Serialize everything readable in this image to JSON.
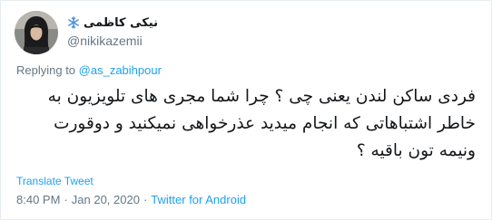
{
  "tweet": {
    "author": {
      "display_name": "نیکی کاظمی",
      "handle": "@nikikazemii",
      "name_emoji_icon": "snowflake-icon"
    },
    "replying_to": {
      "prefix": "Replying to",
      "mention": "@as_zabihpour"
    },
    "text": "فردی ساکن لندن یعنی چی ؟ چرا شما مجری های تلویزیون به خاطر اشتباهاتی که انجام میدید عذرخواهی نمیکنید و دوقورت ونیمه تون باقیه ؟",
    "translate_label": "Translate Tweet",
    "time": "8:40 PM",
    "date": "Jan 20, 2020",
    "separator": "·",
    "source": "Twitter for Android"
  },
  "colors": {
    "link": "#1da1f2",
    "muted": "#657786",
    "text": "#14171a",
    "snowflake": "#4a90d9"
  }
}
